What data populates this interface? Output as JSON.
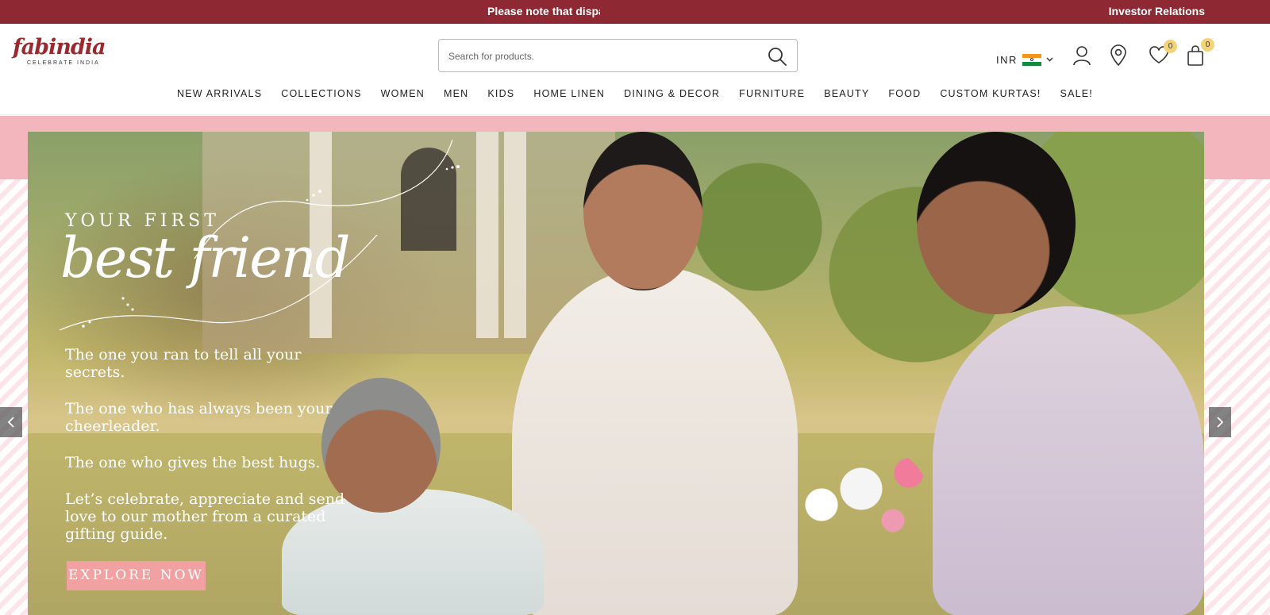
{
  "announcement": {
    "text": "Please note that dispatch times may vary",
    "investor_link": "Investor Relations"
  },
  "brand": {
    "name": "fabindia",
    "tagline": "CELEBRATE INDIA",
    "color": "#9a2a2f"
  },
  "search": {
    "placeholder": "Search for products.",
    "value": ""
  },
  "utility": {
    "currency": "INR",
    "wishlist_count": "0",
    "cart_count": "0"
  },
  "nav": {
    "items": [
      "NEW ARRIVALS",
      "COLLECTIONS",
      "WOMEN",
      "MEN",
      "KIDS",
      "HOME LINEN",
      "DINING & DECOR",
      "FURNITURE",
      "BEAUTY",
      "FOOD",
      "CUSTOM KURTAS!",
      "SALE!"
    ]
  },
  "hero": {
    "eyebrow": "YOUR FIRST",
    "script": "best friend",
    "lines": [
      "The one you ran to tell all your secrets.",
      "The one who has always been your cheerleader.",
      "The one who gives the best hugs.",
      "Let’s celebrate, appreciate and send love to our mother from a curated gifting guide."
    ],
    "cta": "EXPLORE NOW"
  },
  "colors": {
    "announcement_bg": "#8e2934",
    "cta_bg": "#f2a1a3",
    "badge_bg": "#f3d377"
  }
}
